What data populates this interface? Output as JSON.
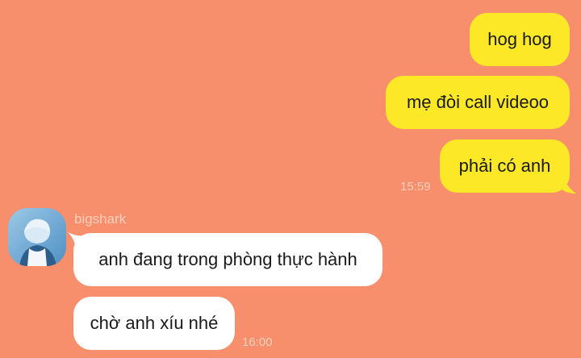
{
  "messages": {
    "outgoing": [
      {
        "text": "hog hog"
      },
      {
        "text": "mẹ đòi call videoo"
      },
      {
        "text": "phải có anh"
      }
    ],
    "outgoing_time": "15:59",
    "sender_name": "bigshark",
    "incoming": [
      {
        "text": "anh đang trong phòng thực hành"
      },
      {
        "text": "chờ anh xíu nhé"
      }
    ],
    "incoming_time": "16:00"
  },
  "colors": {
    "background": "#F78E6C",
    "outgoing_bubble": "#FCE827",
    "incoming_bubble": "#FFFFFF",
    "meta_text": "#FBD0BE"
  },
  "icons": {
    "avatar": "avatar-photo"
  }
}
